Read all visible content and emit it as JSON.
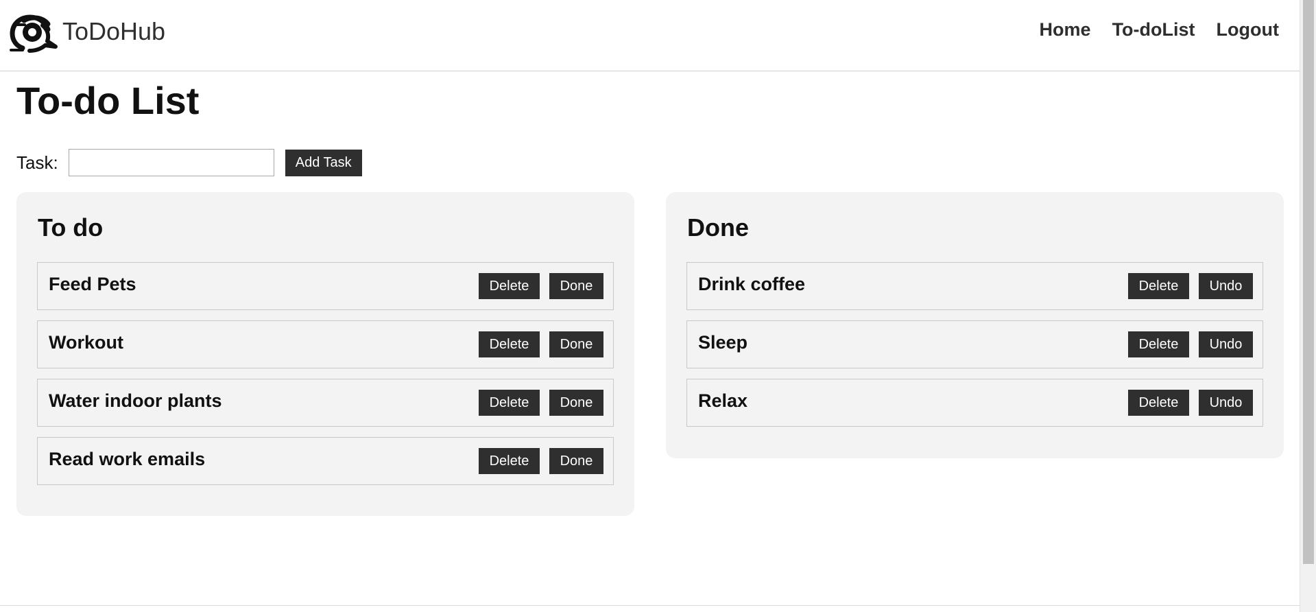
{
  "app": {
    "brand_name": "ToDoHub",
    "logo_icon": "speech-bubble-logo-icon"
  },
  "nav": {
    "items": [
      {
        "label": "Home"
      },
      {
        "label": "To-doList"
      },
      {
        "label": "Logout"
      }
    ]
  },
  "page": {
    "title": "To-do List"
  },
  "task_form": {
    "label": "Task:",
    "input_value": "",
    "input_placeholder": "",
    "button_label": "Add Task"
  },
  "todo": {
    "title": "To do",
    "items": [
      {
        "text": "Feed Pets",
        "delete_label": "Delete",
        "action_label": "Done"
      },
      {
        "text": "Workout",
        "delete_label": "Delete",
        "action_label": "Done"
      },
      {
        "text": "Water indoor plants",
        "delete_label": "Delete",
        "action_label": "Done"
      },
      {
        "text": "Read work emails",
        "delete_label": "Delete",
        "action_label": "Done"
      }
    ]
  },
  "done": {
    "title": "Done",
    "items": [
      {
        "text": "Drink coffee",
        "delete_label": "Delete",
        "action_label": "Undo"
      },
      {
        "text": "Sleep",
        "delete_label": "Delete",
        "action_label": "Undo"
      },
      {
        "text": "Relax",
        "delete_label": "Delete",
        "action_label": "Undo"
      }
    ]
  },
  "colors": {
    "button_bg": "#2f2f2f",
    "panel_bg": "#f3f3f3",
    "border": "#c8c8c8",
    "text": "#111111"
  }
}
